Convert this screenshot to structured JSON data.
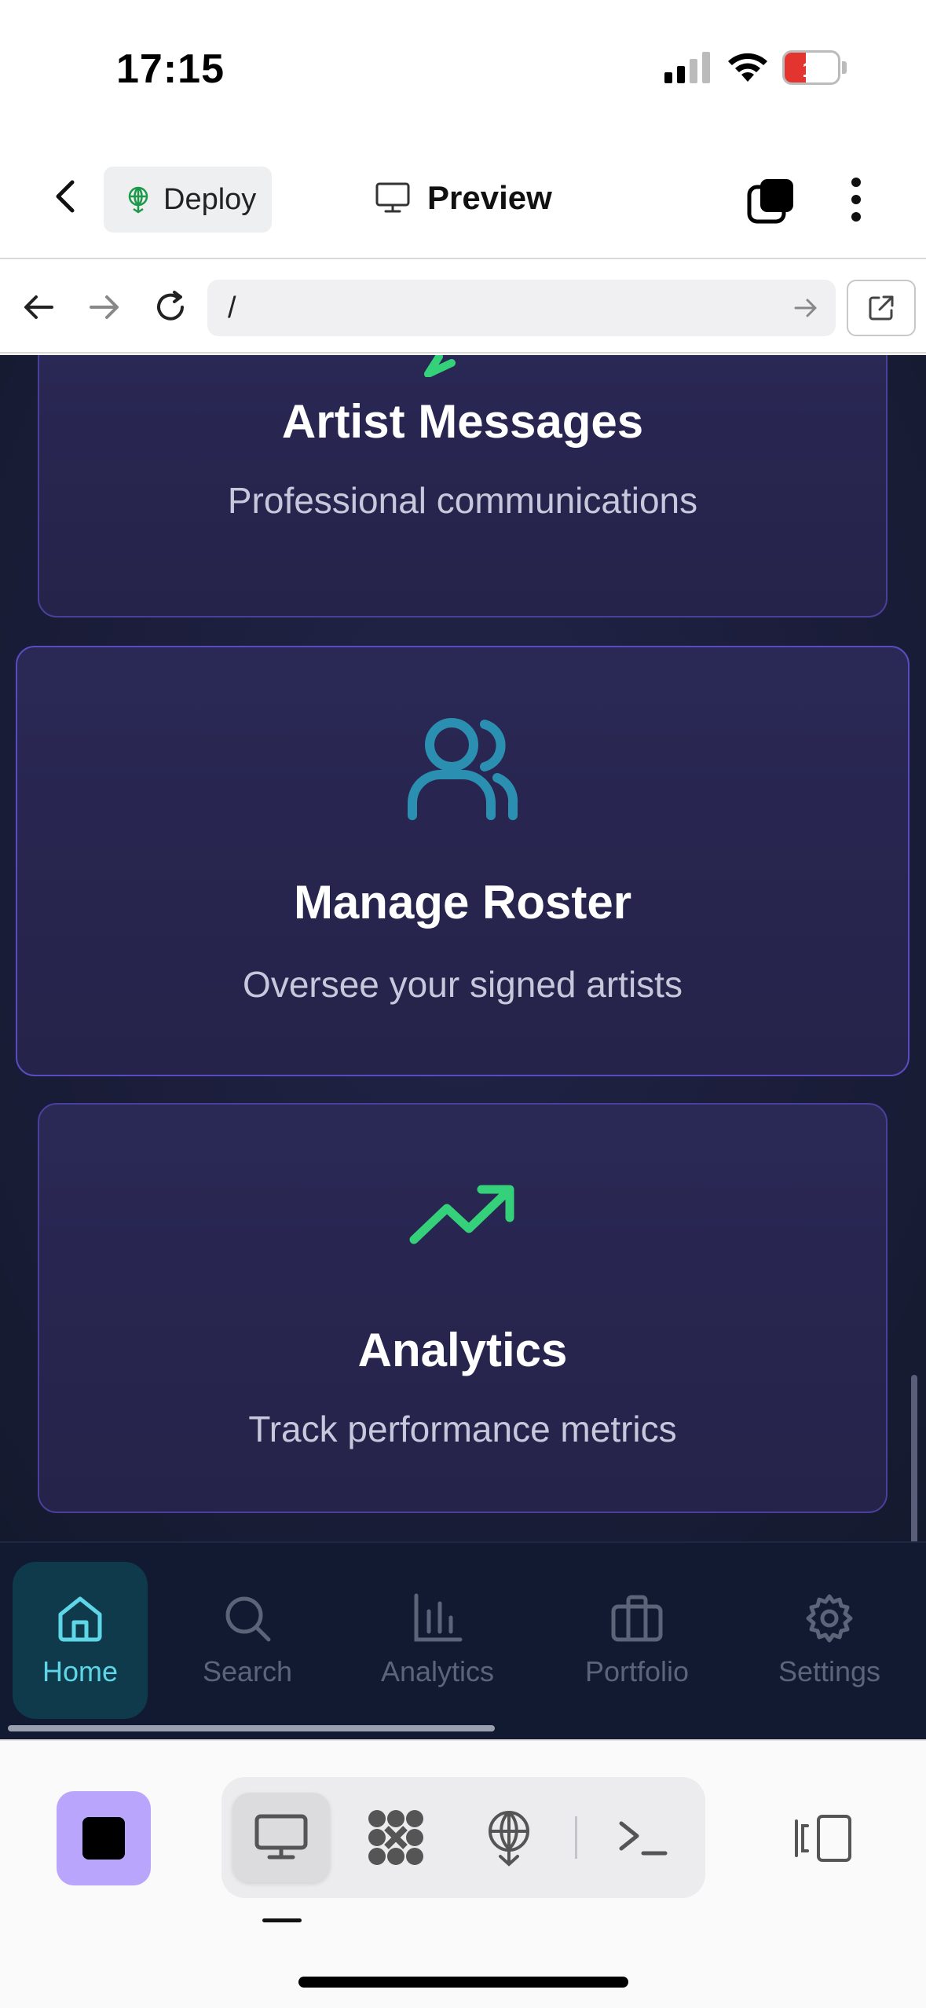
{
  "status_bar": {
    "time": "17:15",
    "battery_level": "11",
    "icons": [
      "signal-icon",
      "wifi-icon",
      "battery-icon"
    ]
  },
  "app_header": {
    "deploy_label": "Deploy",
    "preview_label": "Preview",
    "icons": [
      "back-icon",
      "deploy-icon",
      "monitor-icon",
      "layers-icon",
      "more-vertical-icon"
    ]
  },
  "browser_bar": {
    "url": "/",
    "icons": [
      "arrow-left-icon",
      "arrow-right-icon",
      "reload-icon",
      "go-arrow-icon",
      "external-link-icon"
    ]
  },
  "cards": [
    {
      "title": "Artist Messages",
      "subtitle": "Professional communications",
      "icon": "message-icon",
      "icon_color": "#34d17a"
    },
    {
      "title": "Manage Roster",
      "subtitle": "Oversee your signed artists",
      "icon": "users-icon",
      "icon_color": "#2a8fb0"
    },
    {
      "title": "Analytics",
      "subtitle": "Track performance metrics",
      "icon": "trending-up-icon",
      "icon_color": "#34d17a"
    }
  ],
  "tabbar": {
    "items": [
      {
        "label": "Home",
        "icon": "home-icon",
        "active": true
      },
      {
        "label": "Search",
        "icon": "search-icon",
        "active": false
      },
      {
        "label": "Analytics",
        "icon": "bar-chart-icon",
        "active": false
      },
      {
        "label": "Portfolio",
        "icon": "briefcase-icon",
        "active": false
      },
      {
        "label": "Settings",
        "icon": "settings-icon",
        "active": false
      }
    ]
  },
  "toolbar": {
    "icons": [
      "stop-icon",
      "desktop-icon",
      "network-icon",
      "deploy-icon",
      "terminal-icon",
      "panel-toggle-icon"
    ],
    "active_segment": "desktop",
    "accent": "#b9a5fb"
  },
  "colors": {
    "active_tab": "#5fd6e8",
    "card_border": "#4a3f9a",
    "page_bg": "#1b1d3a"
  }
}
